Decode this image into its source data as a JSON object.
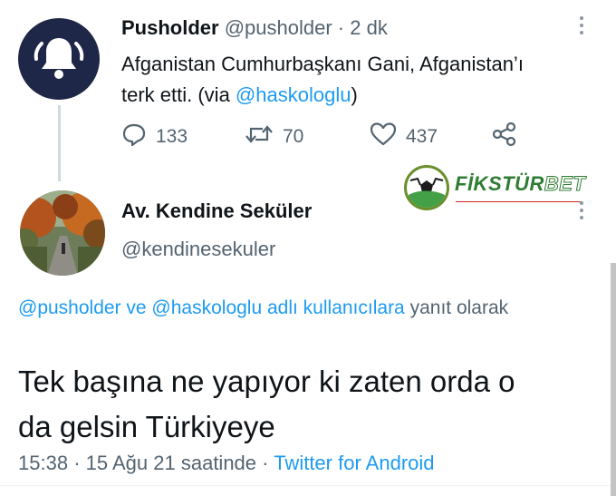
{
  "tweet1": {
    "name": "Pusholder",
    "handle": "@pusholder",
    "sep": "·",
    "time": "2 dk",
    "text_line1": "Afganistan Cumhurbaşkanı Gani, Afganistan’ı",
    "text_line2_prefix": "terk etti. (via ",
    "text_mention": "@haskologlu",
    "text_line2_suffix": ")",
    "avatar_icon": "bell-icon",
    "actions": {
      "replies": "133",
      "retweets": "70",
      "likes": "437"
    }
  },
  "watermark": {
    "brand_part1": "FİKSTÜR",
    "brand_part2": "BET",
    "colors": {
      "green": "#2e7d32",
      "red": "#c62828"
    }
  },
  "tweet2": {
    "name": "Av. Kendine Seküler",
    "handle": "@kendinesekuler",
    "reply_mention1": "@pusholder",
    "reply_and": " ve ",
    "reply_mention2": "@haskologlu",
    "reply_suffix_blue": " adlı kullanıcılara",
    "reply_tail": " yanıt olarak",
    "text_line1": "Tek başına ne yapıyor ki zaten orda o",
    "text_line2": "da gelsin Türkiyeye",
    "time": "15:38",
    "date": "15 Ağu 21 saatinde",
    "sep": "·",
    "source": "Twitter for Android"
  },
  "colors": {
    "accent": "#1d9bf0",
    "text": "#0f1419",
    "secondary": "#536471",
    "avatar_bg": "#1e2747"
  }
}
